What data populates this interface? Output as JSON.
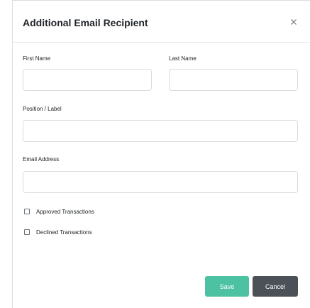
{
  "dialog": {
    "title": "Additional Email Recipient",
    "close_symbol": "×",
    "close_icon": "close-icon"
  },
  "form": {
    "first_name": {
      "label": "First Name",
      "value": "",
      "placeholder": ""
    },
    "last_name": {
      "label": "Last Name",
      "value": "",
      "placeholder": ""
    },
    "position": {
      "label": "Position / Label",
      "value": "",
      "placeholder": ""
    },
    "email": {
      "label": "Email Address",
      "value": "",
      "placeholder": ""
    },
    "checkboxes": [
      {
        "label": "Approved Transactions",
        "checked": false
      },
      {
        "label": "Declined Transactions",
        "checked": false
      }
    ]
  },
  "footer": {
    "save_label": "Save",
    "cancel_label": "Cancel"
  },
  "colors": {
    "save": "#4cc2a3",
    "cancel": "#4b5156"
  }
}
